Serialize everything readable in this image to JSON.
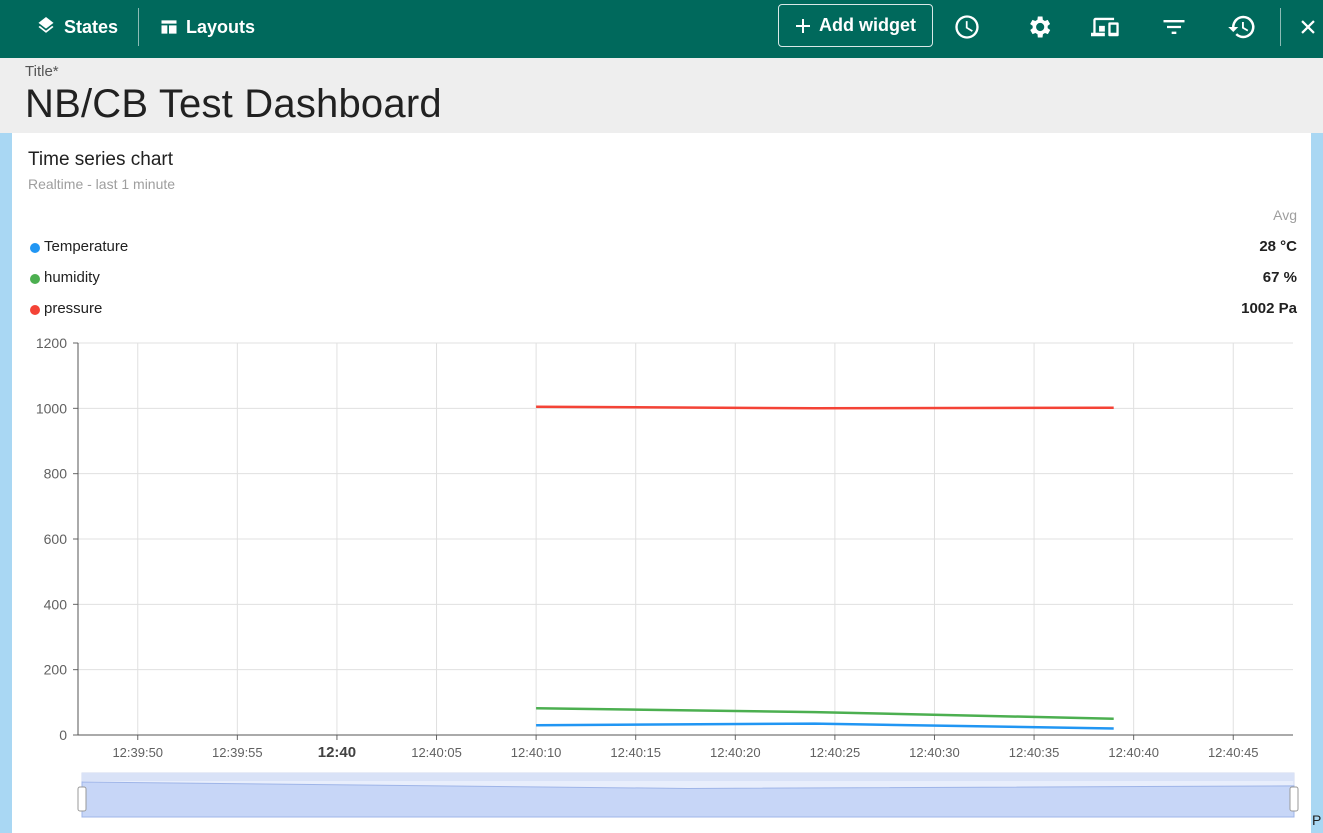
{
  "toolbar": {
    "states_label": "States",
    "layouts_label": "Layouts",
    "add_widget_label": "Add widget"
  },
  "header": {
    "title_label": "Title*",
    "title_value": "NB/CB Test Dashboard"
  },
  "widget": {
    "title": "Time series chart",
    "subtitle": "Realtime - last 1 minute",
    "legend_value_header": "Avg",
    "legend": [
      {
        "name": "Temperature",
        "value": "28 °C",
        "color": "#2196f3"
      },
      {
        "name": "humidity",
        "value": "67 %",
        "color": "#4caf50"
      },
      {
        "name": "pressure",
        "value": "1002 Pa",
        "color": "#f44336"
      }
    ]
  },
  "chart_data": {
    "type": "line",
    "title": "",
    "xlabel": "",
    "ylabel": "",
    "ylim": [
      0,
      1200
    ],
    "y_ticks": [
      "0",
      "200",
      "400",
      "600",
      "800",
      "1000",
      "1200"
    ],
    "x_range": [
      "12:39:47",
      "12:40:48"
    ],
    "x_ticks": [
      {
        "label": "12:39:50",
        "time": "12:39:50",
        "bold": false
      },
      {
        "label": "12:39:55",
        "time": "12:39:55",
        "bold": false
      },
      {
        "label": "12:40",
        "time": "12:40:00",
        "bold": true
      },
      {
        "label": "12:40:05",
        "time": "12:40:05",
        "bold": false
      },
      {
        "label": "12:40:10",
        "time": "12:40:10",
        "bold": false
      },
      {
        "label": "12:40:15",
        "time": "12:40:15",
        "bold": false
      },
      {
        "label": "12:40:20",
        "time": "12:40:20",
        "bold": false
      },
      {
        "label": "12:40:25",
        "time": "12:40:25",
        "bold": false
      },
      {
        "label": "12:40:30",
        "time": "12:40:30",
        "bold": false
      },
      {
        "label": "12:40:35",
        "time": "12:40:35",
        "bold": false
      },
      {
        "label": "12:40:40",
        "time": "12:40:40",
        "bold": false
      },
      {
        "label": "12:40:45",
        "time": "12:40:45",
        "bold": false
      }
    ],
    "grid": true,
    "series": [
      {
        "name": "Temperature",
        "color": "#2196f3",
        "points": [
          [
            "12:40:10",
            30
          ],
          [
            "12:40:24",
            35
          ],
          [
            "12:40:39",
            20
          ]
        ]
      },
      {
        "name": "humidity",
        "color": "#4caf50",
        "points": [
          [
            "12:40:10",
            82
          ],
          [
            "12:40:24",
            70
          ],
          [
            "12:40:39",
            50
          ]
        ]
      },
      {
        "name": "pressure",
        "color": "#f44336",
        "points": [
          [
            "12:40:10",
            1005
          ],
          [
            "12:40:24",
            1000
          ],
          [
            "12:40:39",
            1002
          ]
        ]
      }
    ]
  },
  "footer_partial_text": "P"
}
